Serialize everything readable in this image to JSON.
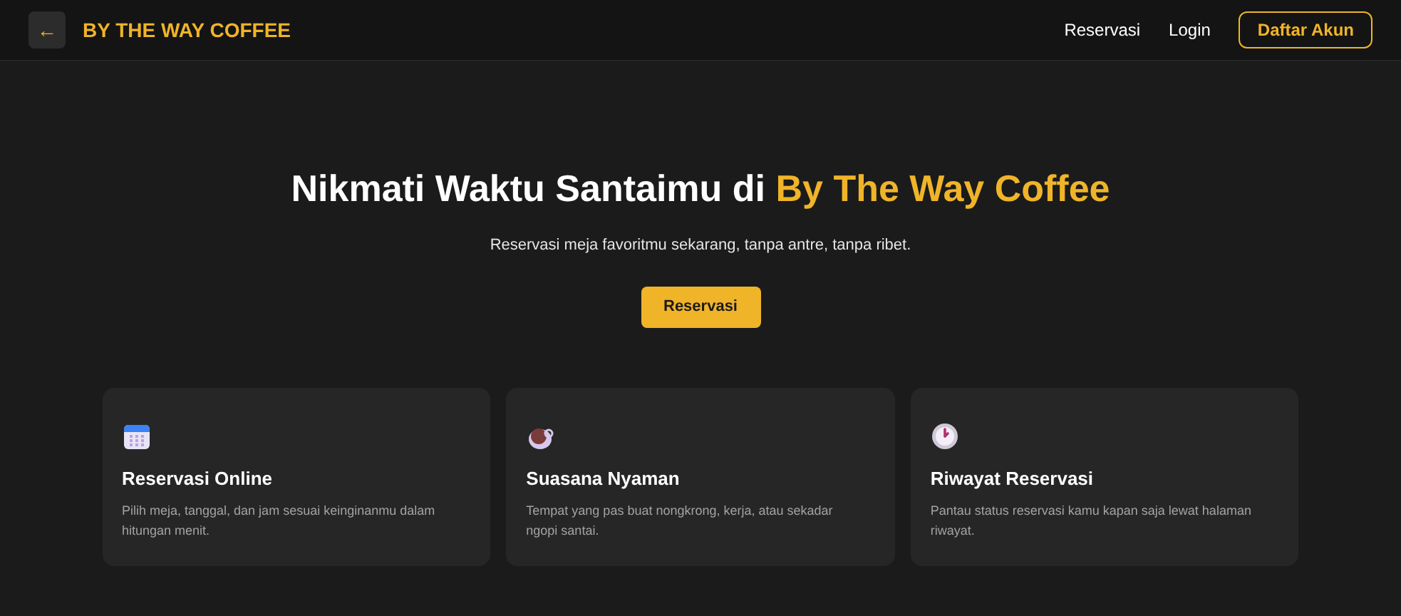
{
  "navbar": {
    "back": "←",
    "brand": "BY THE WAY COFFEE",
    "links": [
      "Reservasi",
      "Login"
    ],
    "cta": "Daftar Akun"
  },
  "hero": {
    "title": "Nikmati Waktu Santaimu di",
    "highlight": "By The Way Coffee",
    "subtitle": "Reservasi meja favoritmu sekarang, tanpa antre, tanpa ribet.",
    "button": "Reservasi"
  },
  "features": [
    {
      "kind": "calendar",
      "title": "Reservasi Online",
      "text": "Pilih meja, tanggal, dan jam sesuai keinginanmu dalam hitungan menit."
    },
    {
      "kind": "coffee",
      "title": "Suasana Nyaman",
      "text": "Tempat yang pas buat nongkrong, kerja, atau sekadar ngopi santai."
    },
    {
      "kind": "clock",
      "title": "Riwayat Reservasi",
      "text": "Pantau status reservasi kamu kapan saja lewat halaman riwayat."
    }
  ]
}
